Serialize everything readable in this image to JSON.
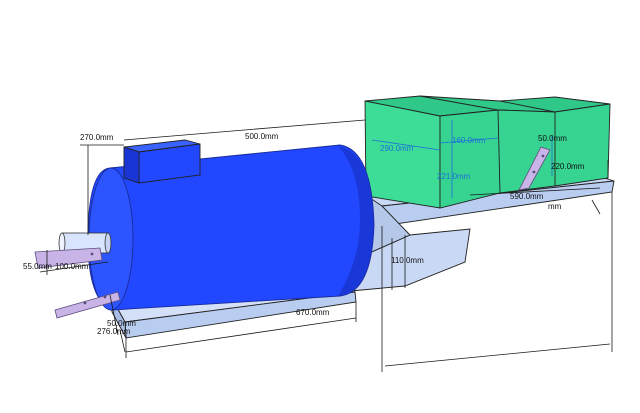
{
  "viewport": {
    "background": "#ffffff",
    "colors": {
      "motor_body": "#2148ff",
      "motor_shadow": "#1228b8",
      "pump_face": "#3ddc97",
      "pump_top": "#2fc888",
      "frame": "#c9d8f5",
      "frame_dark": "#a9bde6",
      "bracket": "#c9b4e8",
      "shaft": "#d9e4ff",
      "dimension_blue": "#1d6fd8"
    }
  },
  "dimensions": {
    "d_270": "270.0mm",
    "d_500": "500.0mm",
    "d_290": "290.0mm",
    "d_160": "160.0mm",
    "d_221": "221.0mm",
    "d_50_top": "50.0mm",
    "d_220": "220.0mm",
    "d_590": "590.0mm",
    "d_mm_tail": "mm",
    "d_55": "55.0mm",
    "d_100": "100.0mm",
    "d_110": "110.0mm",
    "d_670": "670.0mm",
    "d_50_left": "50.0mm",
    "d_276": "276.0mm"
  }
}
